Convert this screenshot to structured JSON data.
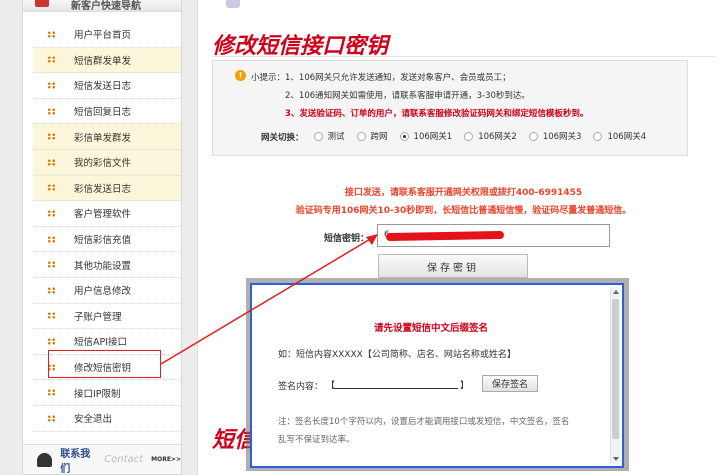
{
  "sidebar": {
    "header": "新客户快速导航",
    "items": [
      {
        "label": "用户平台首页",
        "alt": false
      },
      {
        "label": "短信群发单发",
        "alt": true
      },
      {
        "label": "短信发送日志",
        "alt": false
      },
      {
        "label": "短信回复日志",
        "alt": false
      },
      {
        "label": "彩信单发群发",
        "alt": true
      },
      {
        "label": "我的彩信文件",
        "alt": true
      },
      {
        "label": "彩信发送日志",
        "alt": true
      },
      {
        "label": "客户管理软件",
        "alt": false
      },
      {
        "label": "短信彩信充值",
        "alt": false
      },
      {
        "label": "其他功能设置",
        "alt": false
      },
      {
        "label": "用户信息修改",
        "alt": false
      },
      {
        "label": "子账户管理",
        "alt": false
      },
      {
        "label": "短信API接口",
        "alt": false
      },
      {
        "label": "修改短信密钥",
        "alt": false
      },
      {
        "label": "接口IP限制",
        "alt": false
      },
      {
        "label": "安全退出",
        "alt": false
      }
    ],
    "contact": {
      "cn": "联系我们",
      "en": "Contact",
      "more": "MORE>>"
    }
  },
  "main": {
    "title": "修改短信接口密钥",
    "tips": {
      "line1": "小提示：1、106网关只允许发送通知，发送对象客户、会员或员工；",
      "line2": "2、106通知网关如需使用，请联系客服申请开通，3-30秒到达。",
      "line3": "3、发送验证码、订单的用户，请联系客服修改验证码网关和绑定短信模板秒到。"
    },
    "gateway": {
      "label": "网关切换：",
      "options": [
        {
          "label": "测试",
          "selected": false
        },
        {
          "label": "跨网",
          "selected": false
        },
        {
          "label": "106网关1",
          "selected": true
        },
        {
          "label": "106网关2",
          "selected": false
        },
        {
          "label": "106网关3",
          "selected": false
        },
        {
          "label": "106网关4",
          "selected": false
        }
      ]
    },
    "notice1": "接口发送，请联系客服开通网关权限或拨打400-6991455",
    "notice2": "验证码专用106网关10-30秒即到，长短信比普通短信慢，验证码尽量发普通短信。",
    "key_label": "短信密钥：",
    "key_value_start": "6",
    "save_key_button": "保存密钥",
    "bottom_title_fragment": "短信"
  },
  "modal": {
    "title": "请先设置短信中文后缀签名",
    "example": "如：短信内容XXXXX【公司简称、店名、网站名称或姓名】",
    "sign_label": "签名内容：",
    "bracket_open": "【",
    "bracket_close": "】",
    "save_button": "保存签名",
    "note1": "注：签名长度10个字符以内，设置后才能调用接口或发短信，中文签名，签名",
    "note2": "乱写不保证到达率。"
  },
  "colors": {
    "accent_red": "#d0021b",
    "modal_border": "#2b5fdb",
    "bullet": "#e07b00"
  }
}
